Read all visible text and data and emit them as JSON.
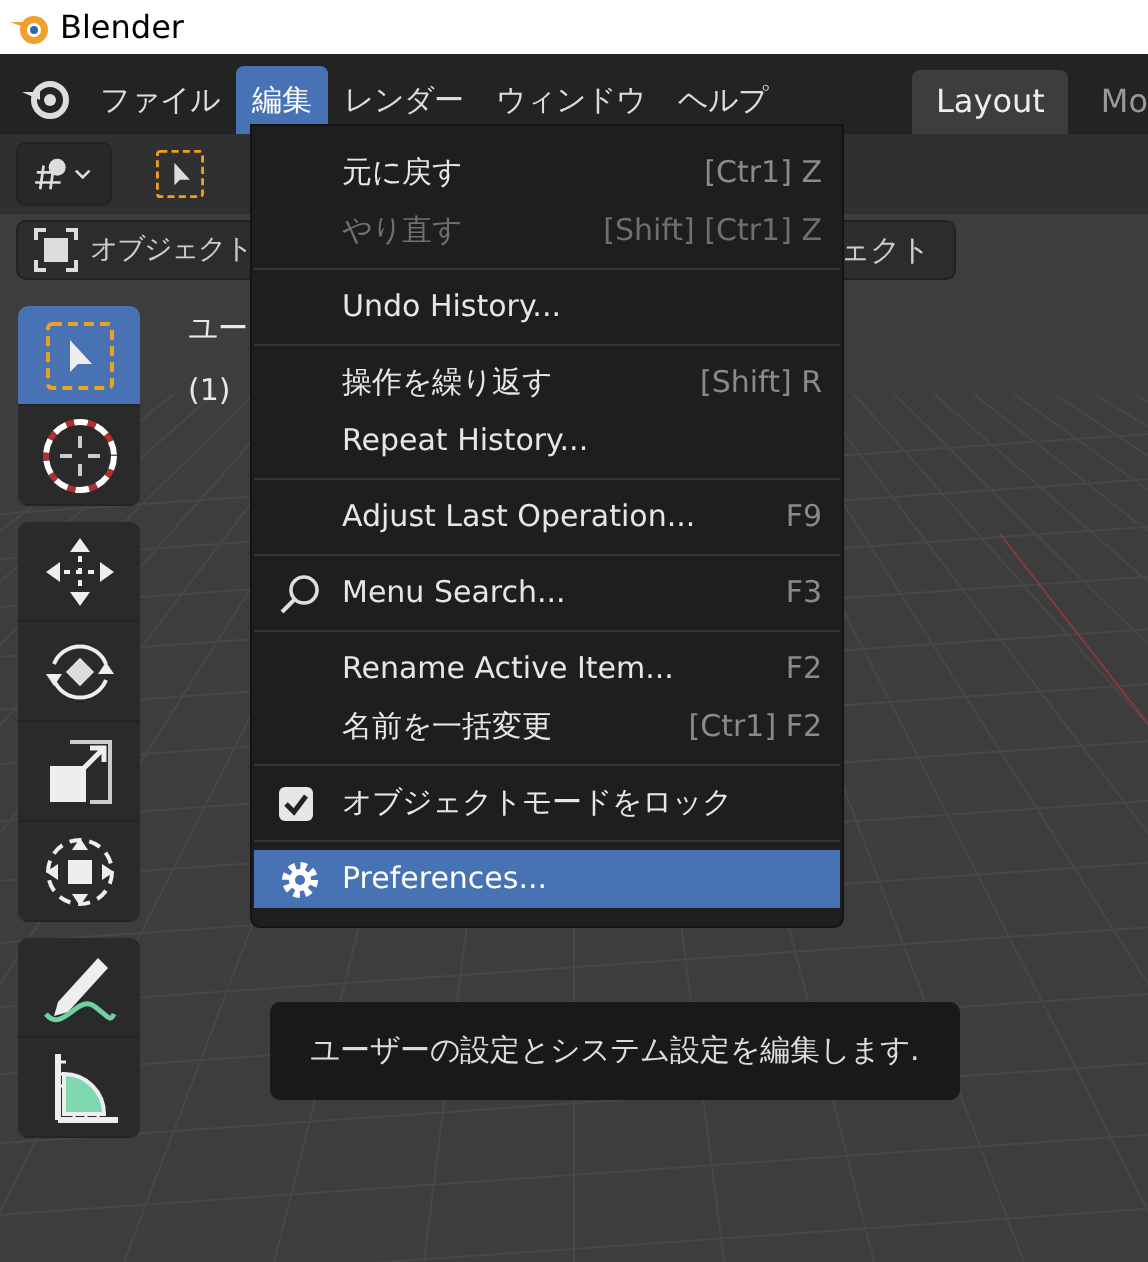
{
  "window": {
    "title": "Blender"
  },
  "menubar": [
    {
      "label": "ファイル",
      "selected": false
    },
    {
      "label": "編集",
      "selected": true
    },
    {
      "label": "レンダー",
      "selected": false
    },
    {
      "label": "ウィンドウ",
      "selected": false
    },
    {
      "label": "ヘルプ",
      "selected": false
    }
  ],
  "workspace_tabs": [
    {
      "label": "Layout",
      "selected": true
    },
    {
      "label": "Mo",
      "selected": false
    }
  ],
  "header": {
    "object_mode": "オブジェクト",
    "menu_fragment": "ェクト"
  },
  "viewport": {
    "overlay_lines": [
      "ユー",
      "(1)"
    ]
  },
  "toolbar": [
    {
      "tools": [
        {
          "kind": "select",
          "selected": true
        },
        {
          "kind": "cursor",
          "selected": false
        }
      ]
    },
    {
      "tools": [
        {
          "kind": "move",
          "selected": false
        },
        {
          "kind": "rotate",
          "selected": false
        },
        {
          "kind": "scale",
          "selected": false
        },
        {
          "kind": "transform",
          "selected": false
        }
      ]
    },
    {
      "tools": [
        {
          "kind": "annotate",
          "selected": false
        },
        {
          "kind": "measure",
          "selected": false
        }
      ]
    }
  ],
  "edit_menu": [
    {
      "items": [
        {
          "kind": "plain",
          "label": "元に戻す",
          "shortcut": "[Ctr1] Z",
          "disabled": false,
          "selected": false
        },
        {
          "kind": "plain",
          "label": "やり直す",
          "shortcut": "[Shift] [Ctr1] Z",
          "disabled": true,
          "selected": false
        }
      ]
    },
    {
      "items": [
        {
          "kind": "plain",
          "label": "Undo History...",
          "disabled": false,
          "selected": false
        }
      ]
    },
    {
      "items": [
        {
          "kind": "plain",
          "label": "操作を繰り返す",
          "shortcut": "[Shift] R",
          "disabled": false,
          "selected": false
        },
        {
          "kind": "plain",
          "label": "Repeat History...",
          "disabled": false,
          "selected": false
        }
      ]
    },
    {
      "items": [
        {
          "kind": "plain",
          "label": "Adjust Last Operation...",
          "shortcut": "F9",
          "disabled": false,
          "selected": false
        }
      ]
    },
    {
      "items": [
        {
          "kind": "search",
          "label": "Menu Search...",
          "shortcut": "F3",
          "disabled": false,
          "selected": false
        }
      ]
    },
    {
      "items": [
        {
          "kind": "plain",
          "label": "Rename Active Item...",
          "shortcut": "F2",
          "disabled": false,
          "selected": false
        },
        {
          "kind": "plain",
          "label": "名前を一括変更",
          "shortcut": "[Ctr1] F2",
          "disabled": false,
          "selected": false
        }
      ]
    },
    {
      "items": [
        {
          "kind": "checkbox",
          "label": "オブジェクトモードをロック",
          "checked": true,
          "disabled": false,
          "selected": false
        }
      ]
    },
    {
      "items": [
        {
          "kind": "settings",
          "label": "Preferences...",
          "disabled": false,
          "selected": true
        }
      ]
    }
  ],
  "tooltip": {
    "text": "ユーザーの設定とシステム設定を編集します."
  }
}
